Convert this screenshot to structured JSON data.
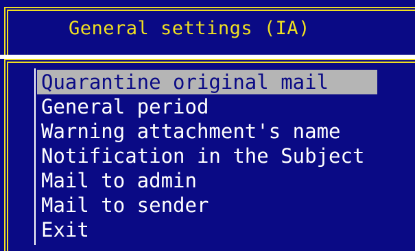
{
  "window": {
    "title": "General settings (IA)"
  },
  "menu": {
    "items": [
      {
        "label": "Quarantine original mail",
        "selected": true
      },
      {
        "label": "General period",
        "selected": false
      },
      {
        "label": "Warning attachment's name",
        "selected": false
      },
      {
        "label": "Notification in the Subject",
        "selected": false
      },
      {
        "label": "Mail to admin",
        "selected": false
      },
      {
        "label": "Mail to sender",
        "selected": false
      },
      {
        "label": "Exit",
        "selected": false
      }
    ]
  },
  "colors": {
    "background": "#0a0a85",
    "border": "#f0e020",
    "title_text": "#f0e020",
    "menu_text": "#ffffff",
    "highlight": "#b5b5b5"
  }
}
